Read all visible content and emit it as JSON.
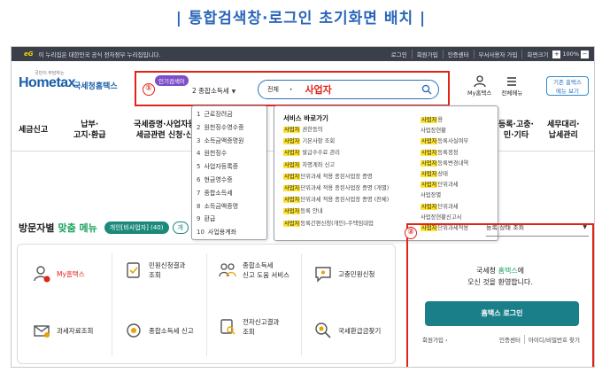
{
  "page_title": "| 통합검색창·로그인 초기화면 배치 |",
  "govbar": {
    "eg_logo": "eG",
    "notice": "이 누리집은 대한민국 공식 전자정부 누리집입니다.",
    "links": [
      "로그인",
      "회원가입",
      "인증센터",
      "부서사용자 가입",
      "화면크기"
    ],
    "zoom_plus": "+",
    "zoom_level": "100%",
    "zoom_minus": "−"
  },
  "logo": {
    "slogan": "국민이 부담하는",
    "brand_main": "Hometax",
    "brand_kr": "국세청홈택스"
  },
  "markers": {
    "one": "①",
    "two": "②"
  },
  "search": {
    "popular_badge": "인기검색어",
    "type_selected": "2 종합소득세",
    "category": "전체",
    "query": "사업자"
  },
  "header_icons": {
    "my_hometax": "My홈택스",
    "all_menu": "전체메뉴",
    "classic_line1": "기존 홈택스",
    "classic_line2": "메뉴 보기"
  },
  "nav": {
    "items": [
      {
        "l1": "세금신고",
        "l2": ""
      },
      {
        "l1": "납부·",
        "l2": "고지·환급"
      },
      {
        "l1": "국세증명·사업자등",
        "l2": "세금관련 신청·신"
      },
      {
        "l1": "등록·고충·",
        "l2": "민·기타"
      },
      {
        "l1": "세무대리·",
        "l2": "납세관리"
      }
    ]
  },
  "popular_list": [
    {
      "num": "1",
      "text": "근로장려금"
    },
    {
      "num": "2",
      "text": "원천징수영수증"
    },
    {
      "num": "3",
      "text": "소득금액증명원"
    },
    {
      "num": "4",
      "text": "원천징수"
    },
    {
      "num": "5",
      "text": "사업자등록증"
    },
    {
      "num": "6",
      "text": "현금영수증"
    },
    {
      "num": "7",
      "text": "종합소득세"
    },
    {
      "num": "8",
      "text": "소득금액증명"
    },
    {
      "num": "9",
      "text": "환급"
    },
    {
      "num": "10",
      "text": "사업용계좌"
    }
  ],
  "service_panel": {
    "heading": "서비스 바로가기",
    "left": [
      {
        "hl": "사업자",
        "rest": " 권한등의"
      },
      {
        "hl": "사업자",
        "rest": " 기본사항 조회"
      },
      {
        "hl": "사업자",
        "rest": " 발급수수료 관리"
      },
      {
        "hl": "사업자",
        "rest": " 차명계좌 신고"
      },
      {
        "hl": "사업자",
        "rest": "단위과세 적용 종된사업장 증명"
      },
      {
        "hl": "사업자",
        "rest": "단위과세 적용 종된사업장 증명 (개별)"
      },
      {
        "hl": "사업자",
        "rest": "단위과세 적용 종된사업장 증명 (전체)"
      },
      {
        "hl": "사업자",
        "rest": "등록 안내"
      },
      {
        "hl": "사업자",
        "rest": "등록간편신청(개인)-주택임대업"
      }
    ],
    "right": [
      {
        "hl": "사업자",
        "rest": "용"
      },
      {
        "hl": "",
        "rest": "사업장현황"
      },
      {
        "hl": "사업자",
        "rest": "등록사실여부"
      },
      {
        "hl": "사업자",
        "rest": "등록정정"
      },
      {
        "hl": "사업자",
        "rest": "등록변경내역"
      },
      {
        "hl": "사업자",
        "rest": "상태"
      },
      {
        "hl": "사업자",
        "rest": "단위과세"
      },
      {
        "hl": "",
        "rest": "사업장별"
      },
      {
        "hl": "사업자",
        "rest": "단위과세"
      },
      {
        "hl": "",
        "rest": "사업장현황신고서"
      },
      {
        "hl": "사업자",
        "rest": "단위과세적용"
      }
    ]
  },
  "visitor": {
    "label": "방문자별",
    "label_accent": "맞춤 메뉴",
    "pill_active": "개인[비사업자] (40)",
    "pill_next": "개",
    "biz_status": "등록 상태 조회"
  },
  "tiles": [
    {
      "l1": "My홈택스",
      "l2": ""
    },
    {
      "l1": "민원신청결과",
      "l2": "조회"
    },
    {
      "l1": "종합소득세",
      "l2": "신고 도움 서비스"
    },
    {
      "l1": "고충민원신청",
      "l2": ""
    },
    {
      "l1": "과세자료조회",
      "l2": ""
    },
    {
      "l1": "종합소득세 신고",
      "l2": ""
    },
    {
      "l1": "전자신고결과",
      "l2": "조회"
    },
    {
      "l1": "국세환급금찾기",
      "l2": ""
    }
  ],
  "login": {
    "welcome_pre": "국세청 ",
    "welcome_accent": "홈택스",
    "welcome_post": "에",
    "welcome_line2": "오신 것을 환영합니다.",
    "button": "홈택스 로그인",
    "signup": "회원가입",
    "cert": "인증센터",
    "find": "아이디/비밀번호 찾기"
  },
  "colors": {
    "accent_blue": "#2a66b8",
    "highlight_red": "#e2231a",
    "brand_green": "#1aa15c",
    "teal": "#1b7f8a",
    "search_highlight": "#ffe433"
  }
}
